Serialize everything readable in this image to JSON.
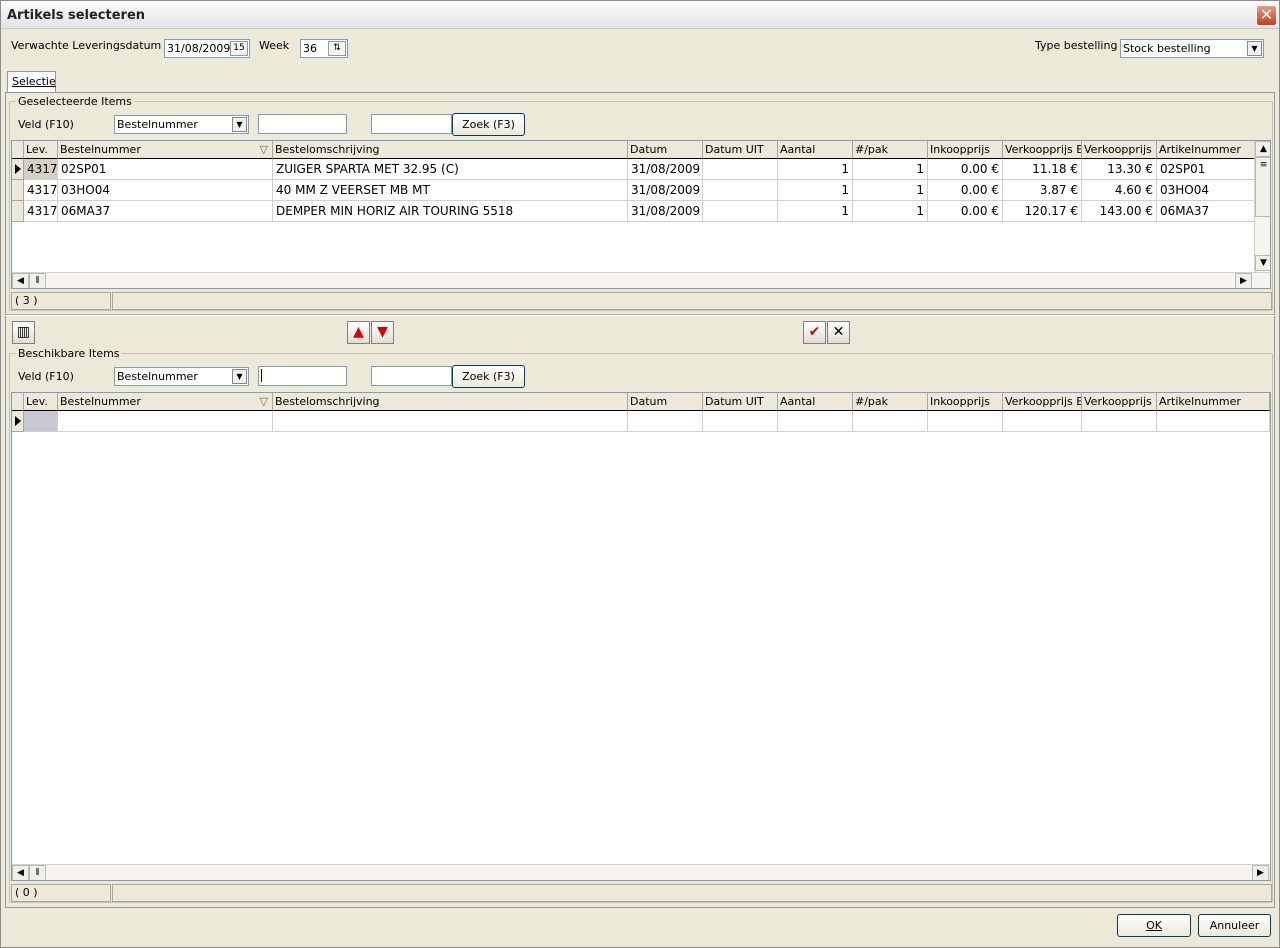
{
  "window": {
    "title": "Artikels selecteren",
    "close_glyph": "✕"
  },
  "header": {
    "delivery_label": "Verwachte Leveringsdatum",
    "delivery_date": "31/08/2009",
    "calendar_glyph": "15",
    "week_label": "Week",
    "week_value": "36",
    "order_type_label": "Type bestelling",
    "order_type_value": "Stock bestelling"
  },
  "tabs": [
    {
      "label": "Selectie"
    }
  ],
  "selected_group": {
    "title": "Geselecteerde Items",
    "field_label": "Veld (F10)",
    "field_value": "Bestelnummer",
    "filter_value": "",
    "search_value": "",
    "search_button": "Zoek (F3)",
    "columns": [
      "Lev.",
      "Bestelnummer",
      "Bestelomschrijving",
      "Datum",
      "Datum UIT",
      "Aantal",
      "#/pak",
      "Inkoopprijs",
      "Verkoopprijs Ex",
      "Verkoopprijs",
      "Artikelnummer"
    ],
    "rows": [
      [
        "4317",
        "02SP01",
        "ZUIGER SPARTA MET 32.95 (C)",
        "31/08/2009",
        "",
        "1",
        "1",
        "0.00 €",
        "11.18 €",
        "13.30 €",
        "02SP01"
      ],
      [
        "4317",
        "03HO04",
        "40 MM Z VEERSET MB MT",
        "31/08/2009",
        "",
        "1",
        "1",
        "0.00 €",
        "3.87 €",
        "4.60 €",
        "03HO04"
      ],
      [
        "4317",
        "06MA37",
        "DEMPER MIN HORIZ AIR TOURING 5518",
        "31/08/2009",
        "",
        "1",
        "1",
        "0.00 €",
        "120.17 €",
        "143.00 €",
        "06MA37"
      ]
    ],
    "count": "( 3 )"
  },
  "toolbar": {
    "columns_glyph": "▥",
    "up_glyph": "▲",
    "down_glyph": "▼",
    "confirm_glyph": "✔",
    "cancel_glyph": "✕"
  },
  "available_group": {
    "title": "Beschikbare Items",
    "field_label": "Veld (F10)",
    "field_value": "Bestelnummer",
    "filter_value": "",
    "search_value": "",
    "search_button": "Zoek (F3)",
    "columns": [
      "Lev.",
      "Bestelnummer",
      "Bestelomschrijving",
      "Datum",
      "Datum UIT",
      "Aantal",
      "#/pak",
      "Inkoopprijs",
      "Verkoopprijs Ex",
      "Verkoopprijs",
      "Artikelnummer"
    ],
    "count": "( 0 )"
  },
  "footer": {
    "ok_label": "OK",
    "cancel_label": "Annuleer"
  },
  "colors": {
    "accent": "#003c74",
    "window_bg": "#ece9d8",
    "close_red": "#c3401f",
    "arrow_red": "#dd0000"
  }
}
